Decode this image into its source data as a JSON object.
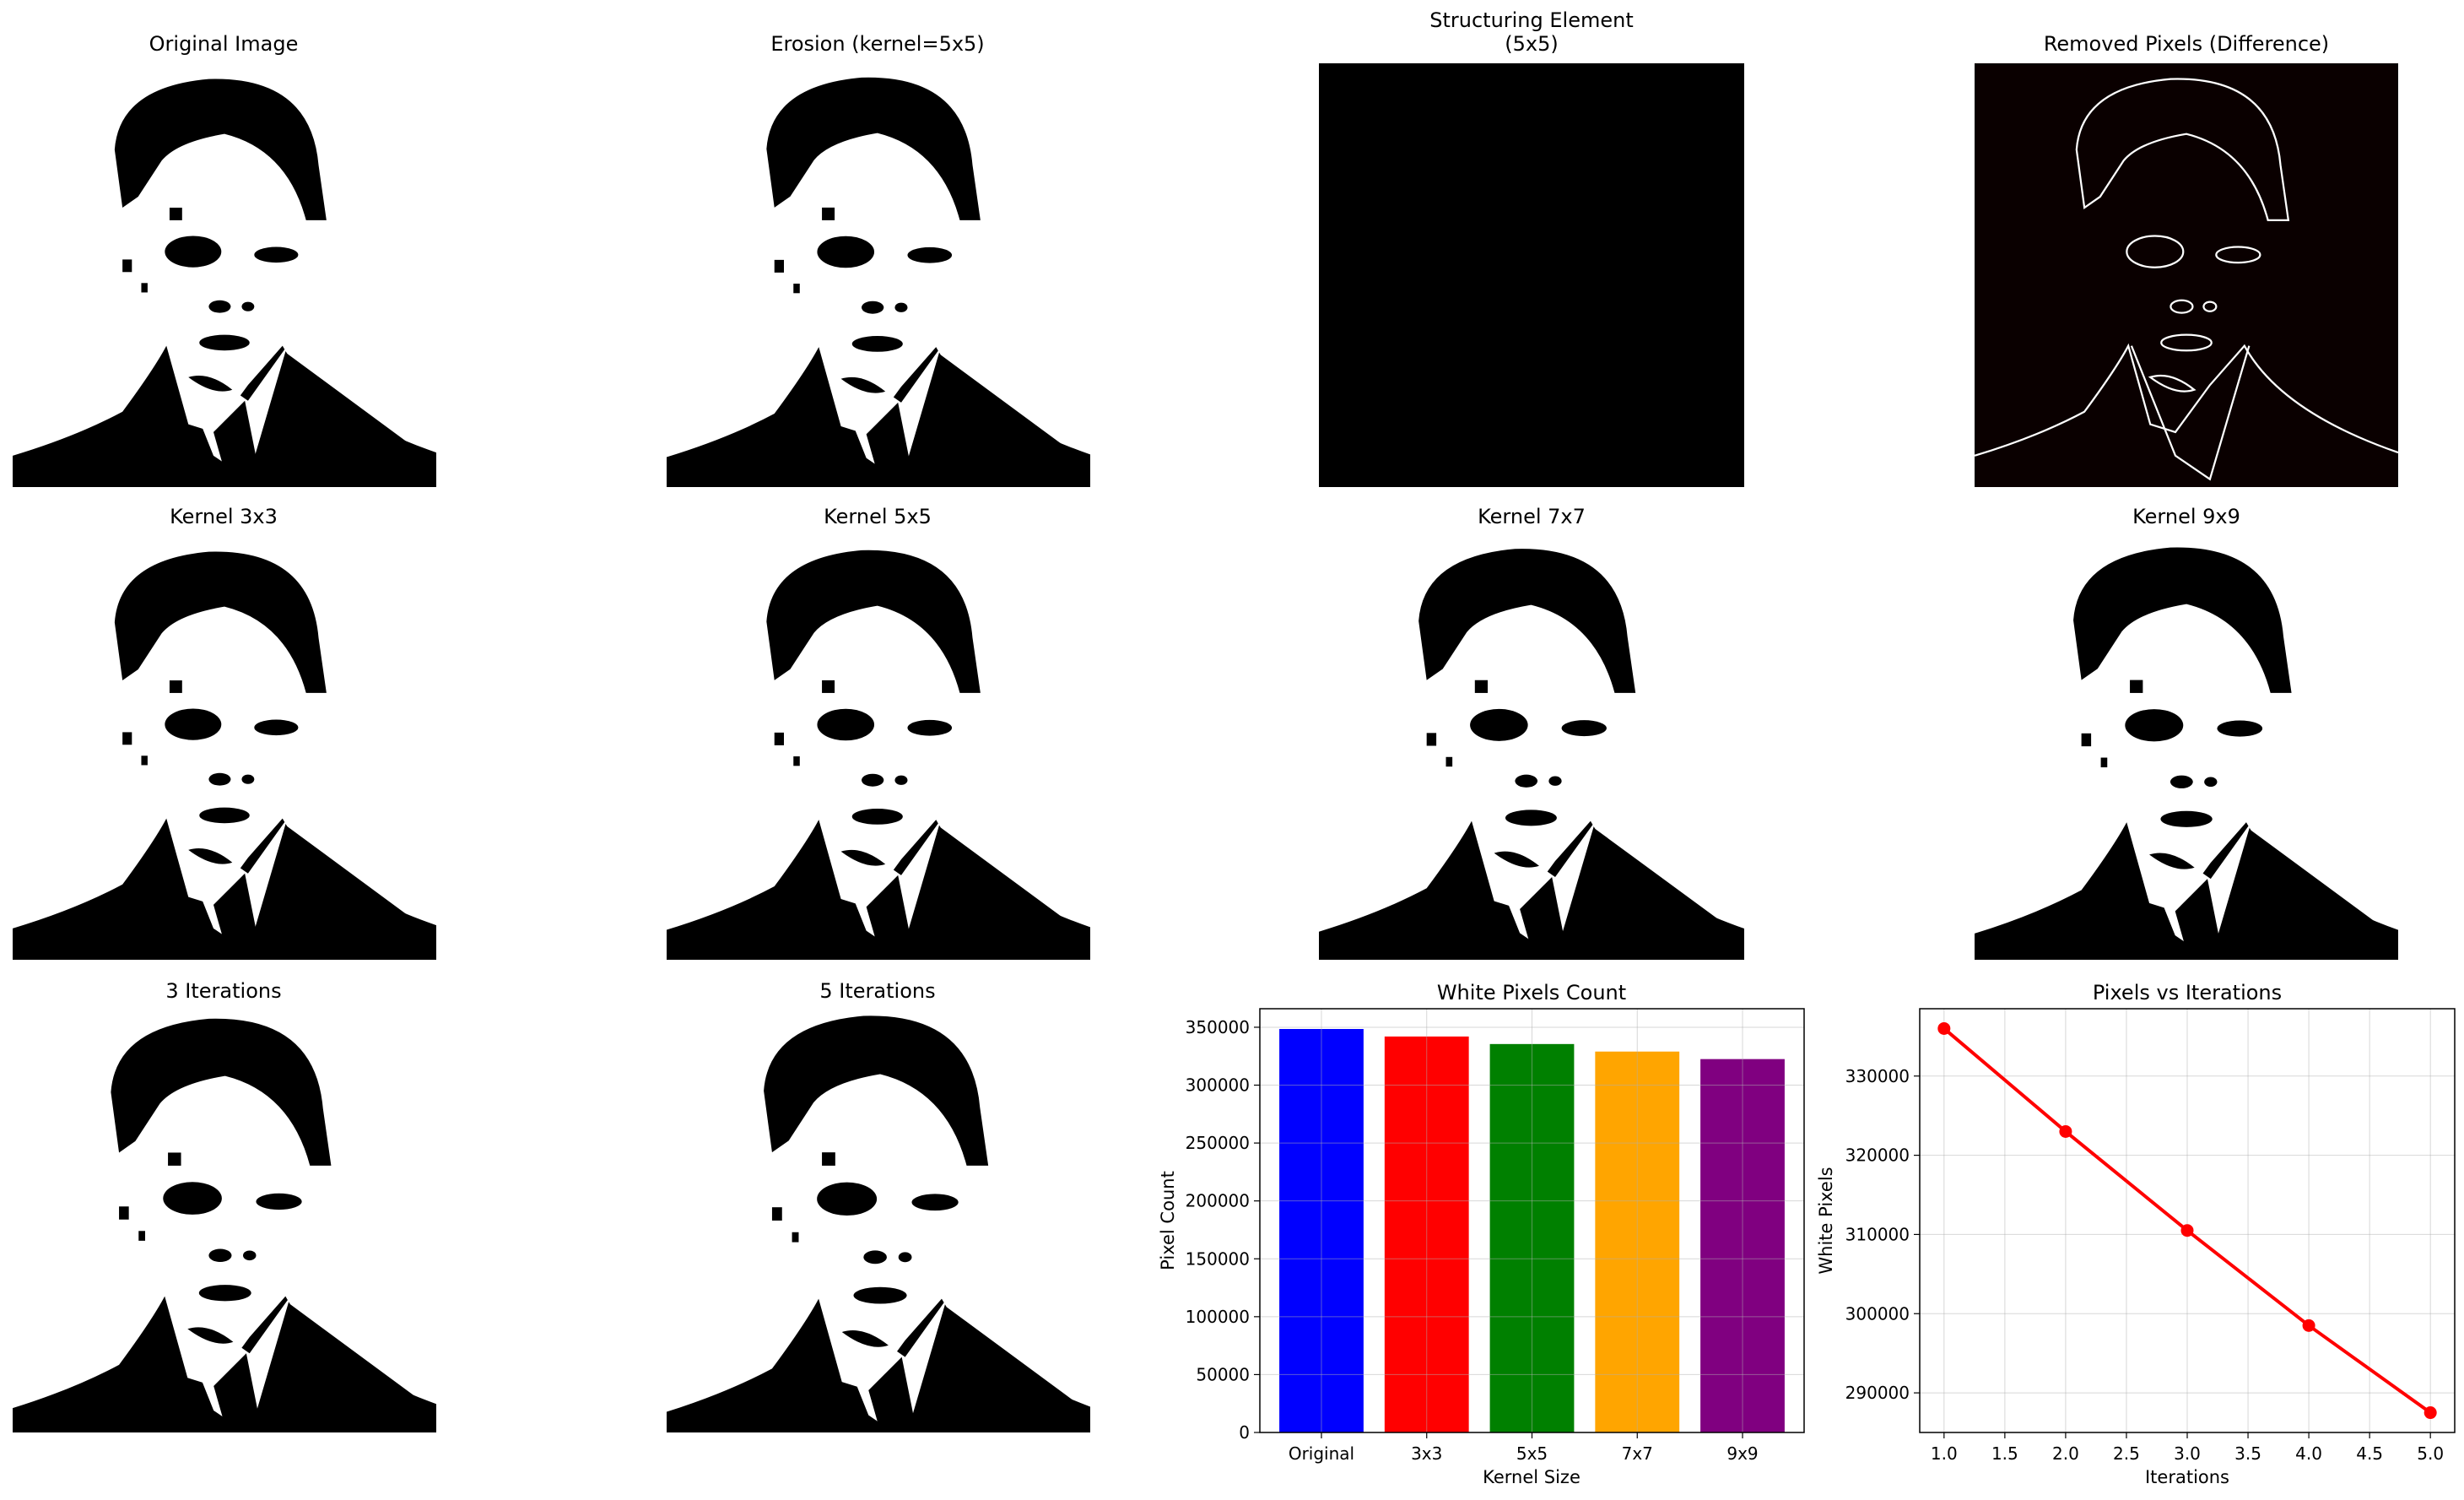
{
  "panels": {
    "original": "Original Image",
    "erosion": "Erosion (kernel=5x5)",
    "struct_line1": "Structuring Element",
    "struct_line2": "(5x5)",
    "difference": "Removed Pixels (Difference)",
    "k3": "Kernel 3x3",
    "k5": "Kernel 5x5",
    "k7": "Kernel 7x7",
    "k9": "Kernel 9x9",
    "it3": "3 Iterations",
    "it5": "5 Iterations"
  },
  "chart_data": [
    {
      "type": "bar",
      "title": "White Pixels Count",
      "xlabel": "Kernel Size",
      "ylabel": "Pixel Count",
      "categories": [
        "Original",
        "3x3",
        "5x5",
        "7x7",
        "9x9"
      ],
      "values": [
        348500,
        342000,
        335500,
        329000,
        322500
      ],
      "colors": [
        "#0000ff",
        "#ff0000",
        "#008000",
        "#ffa500",
        "#800080"
      ],
      "ylim": [
        0,
        366000
      ],
      "yticks": [
        0,
        50000,
        100000,
        150000,
        200000,
        250000,
        300000,
        350000
      ],
      "grid": true
    },
    {
      "type": "line",
      "title": "Pixels vs Iterations",
      "xlabel": "Iterations",
      "ylabel": "White Pixels",
      "x": [
        1,
        2,
        3,
        4,
        5
      ],
      "y": [
        336000,
        323000,
        310500,
        298500,
        287500
      ],
      "color": "#ff0000",
      "xlim": [
        0.8,
        5.2
      ],
      "ylim": [
        285000,
        338500
      ],
      "xticks": [
        1.0,
        1.5,
        2.0,
        2.5,
        3.0,
        3.5,
        4.0,
        4.5,
        5.0
      ],
      "yticks": [
        290000,
        300000,
        310000,
        320000,
        330000
      ],
      "grid": true
    }
  ]
}
